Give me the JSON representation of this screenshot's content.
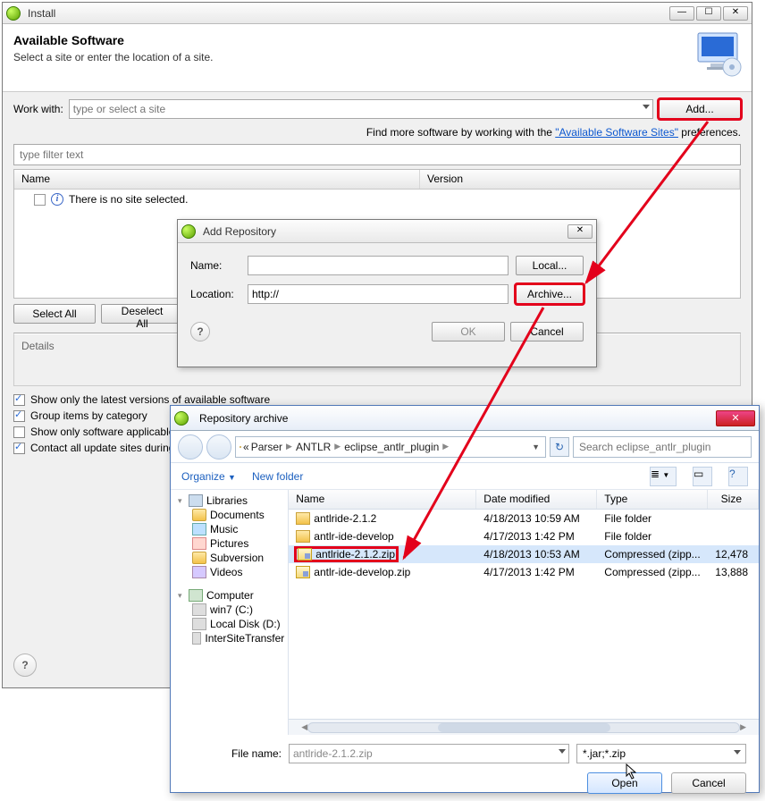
{
  "install_window": {
    "title": "Install",
    "heading": "Available Software",
    "subheading": "Select a site or enter the location of a site.",
    "work_with_label": "Work with:",
    "site_placeholder": "type or select a site",
    "add_btn": "Add...",
    "find_more_prefix": "Find more software by working with the ",
    "find_more_link": "\"Available Software Sites\"",
    "find_more_suffix": " preferences.",
    "filter_placeholder": "type filter text",
    "col_name": "Name",
    "col_version": "Version",
    "no_site_msg": "There is no site selected.",
    "select_all": "Select All",
    "deselect_all": "Deselect All",
    "details_label": "Details",
    "opt_latest": "Show only the latest versions of available software",
    "opt_group": "Group items by category",
    "opt_applicable": "Show only software applicable to target environment",
    "opt_contact": "Contact all update sites during install to find required software"
  },
  "add_repo": {
    "title": "Add Repository",
    "name_label": "Name:",
    "name_value": "",
    "local_btn": "Local...",
    "loc_label": "Location:",
    "loc_value": "http://",
    "archive_btn": "Archive...",
    "ok": "OK",
    "cancel": "Cancel"
  },
  "file_chooser": {
    "title": "Repository archive",
    "breadcrumb": [
      "Parser",
      "ANTLR",
      "eclipse_antlr_plugin"
    ],
    "bc_prefix": "«",
    "search_placeholder": "Search eclipse_antlr_plugin",
    "organize": "Organize",
    "new_folder": "New folder",
    "tree": {
      "libraries": "Libraries",
      "documents": "Documents",
      "music": "Music",
      "pictures": "Pictures",
      "subversion": "Subversion",
      "videos": "Videos",
      "computer": "Computer",
      "win7": "win7 (C:)",
      "localdisk": "Local Disk (D:)",
      "intersite": "InterSiteTransfer"
    },
    "cols": {
      "name": "Name",
      "dm": "Date modified",
      "type": "Type",
      "size": "Size"
    },
    "rows": [
      {
        "name": "antlride-2.1.2",
        "dm": "4/18/2013 10:59 AM",
        "type": "File folder",
        "size": "",
        "kind": "fold",
        "sel": false
      },
      {
        "name": "antlr-ide-develop",
        "dm": "4/17/2013 1:42 PM",
        "type": "File folder",
        "size": "",
        "kind": "fold",
        "sel": false
      },
      {
        "name": "antlride-2.1.2.zip",
        "dm": "4/18/2013 10:53 AM",
        "type": "Compressed (zipp...",
        "size": "12,478",
        "kind": "zip",
        "sel": true
      },
      {
        "name": "antlr-ide-develop.zip",
        "dm": "4/17/2013 1:42 PM",
        "type": "Compressed (zipp...",
        "size": "13,888",
        "kind": "zip",
        "sel": false
      }
    ],
    "filename_label": "File name:",
    "filename_value": "antlride-2.1.2.zip",
    "filetype_value": "*.jar;*.zip",
    "open": "Open",
    "cancel": "Cancel"
  }
}
